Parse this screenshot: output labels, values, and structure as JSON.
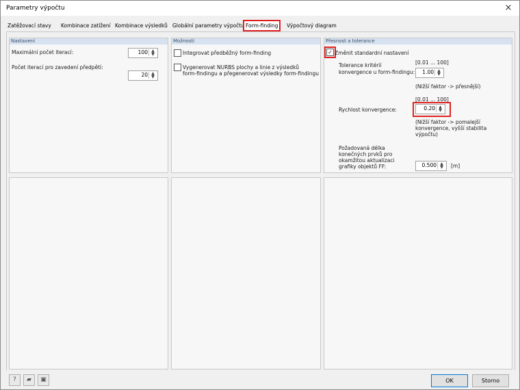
{
  "window": {
    "title": "Parametry výpočtu",
    "close_label": "×"
  },
  "tabs": [
    {
      "label": "Zatěžovací stavy"
    },
    {
      "label": "Kombinace zatížení"
    },
    {
      "label": "Kombinace výsledků"
    },
    {
      "label": "Globální parametry výpočtu"
    },
    {
      "label": "Form-finding",
      "active": true
    },
    {
      "label": "Výpočtový diagram"
    }
  ],
  "settings": {
    "header": "Nastavení",
    "max_iterations_label": "Maximální počet iterací:",
    "max_iterations_value": "100",
    "prestress_iterations_label": "Počet iterací pro zavedení předpětí:",
    "prestress_iterations_value": "20"
  },
  "options": {
    "header": "Možnosti",
    "integrate_label": "Integrovat předběžný form-finding",
    "nurbs_label_1": "Vygenerovat NURBS plochy a linie z výsledků",
    "nurbs_label_2": "form-findingu a přegenerovat výsledky form-findingu"
  },
  "precision": {
    "header": "Přesnost a tolerance",
    "change_label": "Změnit standardní nastavení",
    "change_checked": "✓",
    "tolerance_label_1": "Tolerance kritérií",
    "tolerance_label_2": "konvergence u form-findingu:",
    "tolerance_range": "[0.01 ... 100]",
    "tolerance_value": "1.00",
    "tolerance_hint": "(Nižší faktor -> přesnější)",
    "speed_range": "[0.01 ... 100]",
    "speed_label": "Rychlost konvergence:",
    "speed_value": "0.20",
    "speed_hint_1": "(Nižší faktor -> pomalejší",
    "speed_hint_2": "konvergence, vyšší stabilita",
    "speed_hint_3": "výpočtu)",
    "length_label_1": "Požadovaná délka",
    "length_label_2": "konečných prvků pro",
    "length_label_3": "okamžitou aktualizaci",
    "length_label_4": "grafiky objektů FF:",
    "length_value": "0.500",
    "length_unit": "[m]"
  },
  "footer": {
    "ok_label": "OK",
    "cancel_label": "Storno"
  },
  "icons": {
    "help": "help-icon",
    "open": "open-folder-icon",
    "save": "save-icon"
  }
}
